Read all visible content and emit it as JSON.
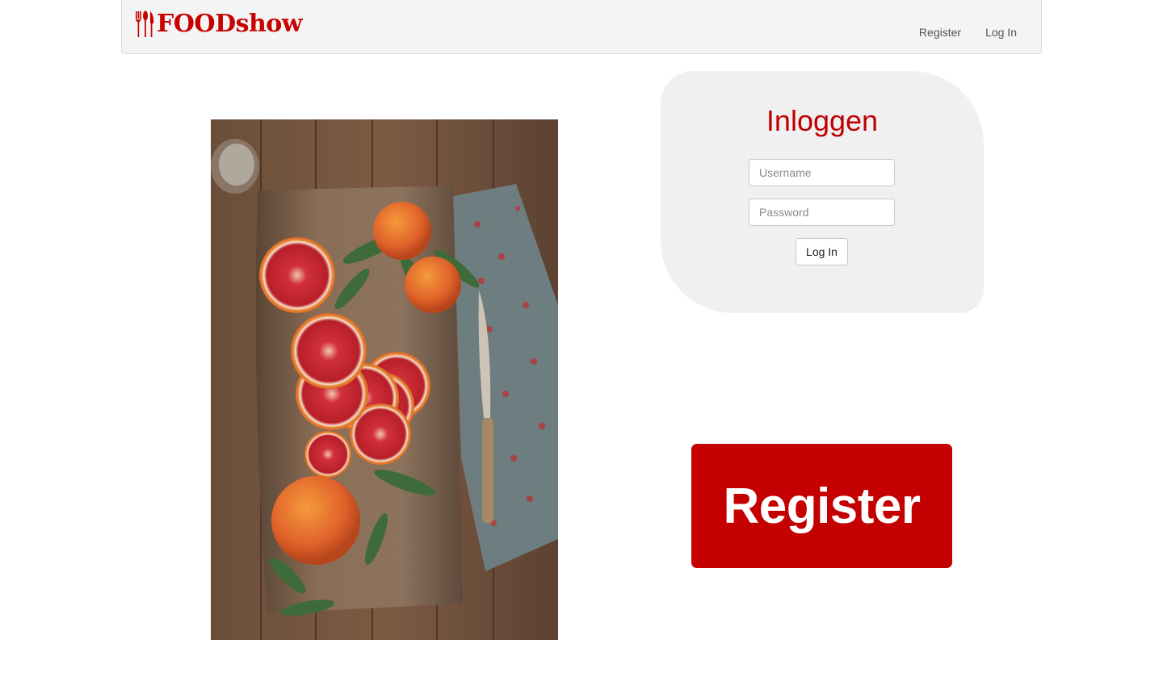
{
  "navbar": {
    "brand": {
      "icon": "cutlery-icon",
      "text": "FOODshow",
      "color": "#c80000"
    },
    "links": [
      {
        "label": "Register"
      },
      {
        "label": "Log In"
      }
    ]
  },
  "photo": {
    "subject": "blood-orange-slices-on-cutting-board"
  },
  "login": {
    "title": "Inloggen",
    "username_placeholder": "Username",
    "username_value": "",
    "password_placeholder": "Password",
    "password_value": "",
    "submit_label": "Log In",
    "panel_color": "#f0f0f0",
    "title_color": "#c00000"
  },
  "register_cta": {
    "label": "Register",
    "color": "#c40000"
  }
}
